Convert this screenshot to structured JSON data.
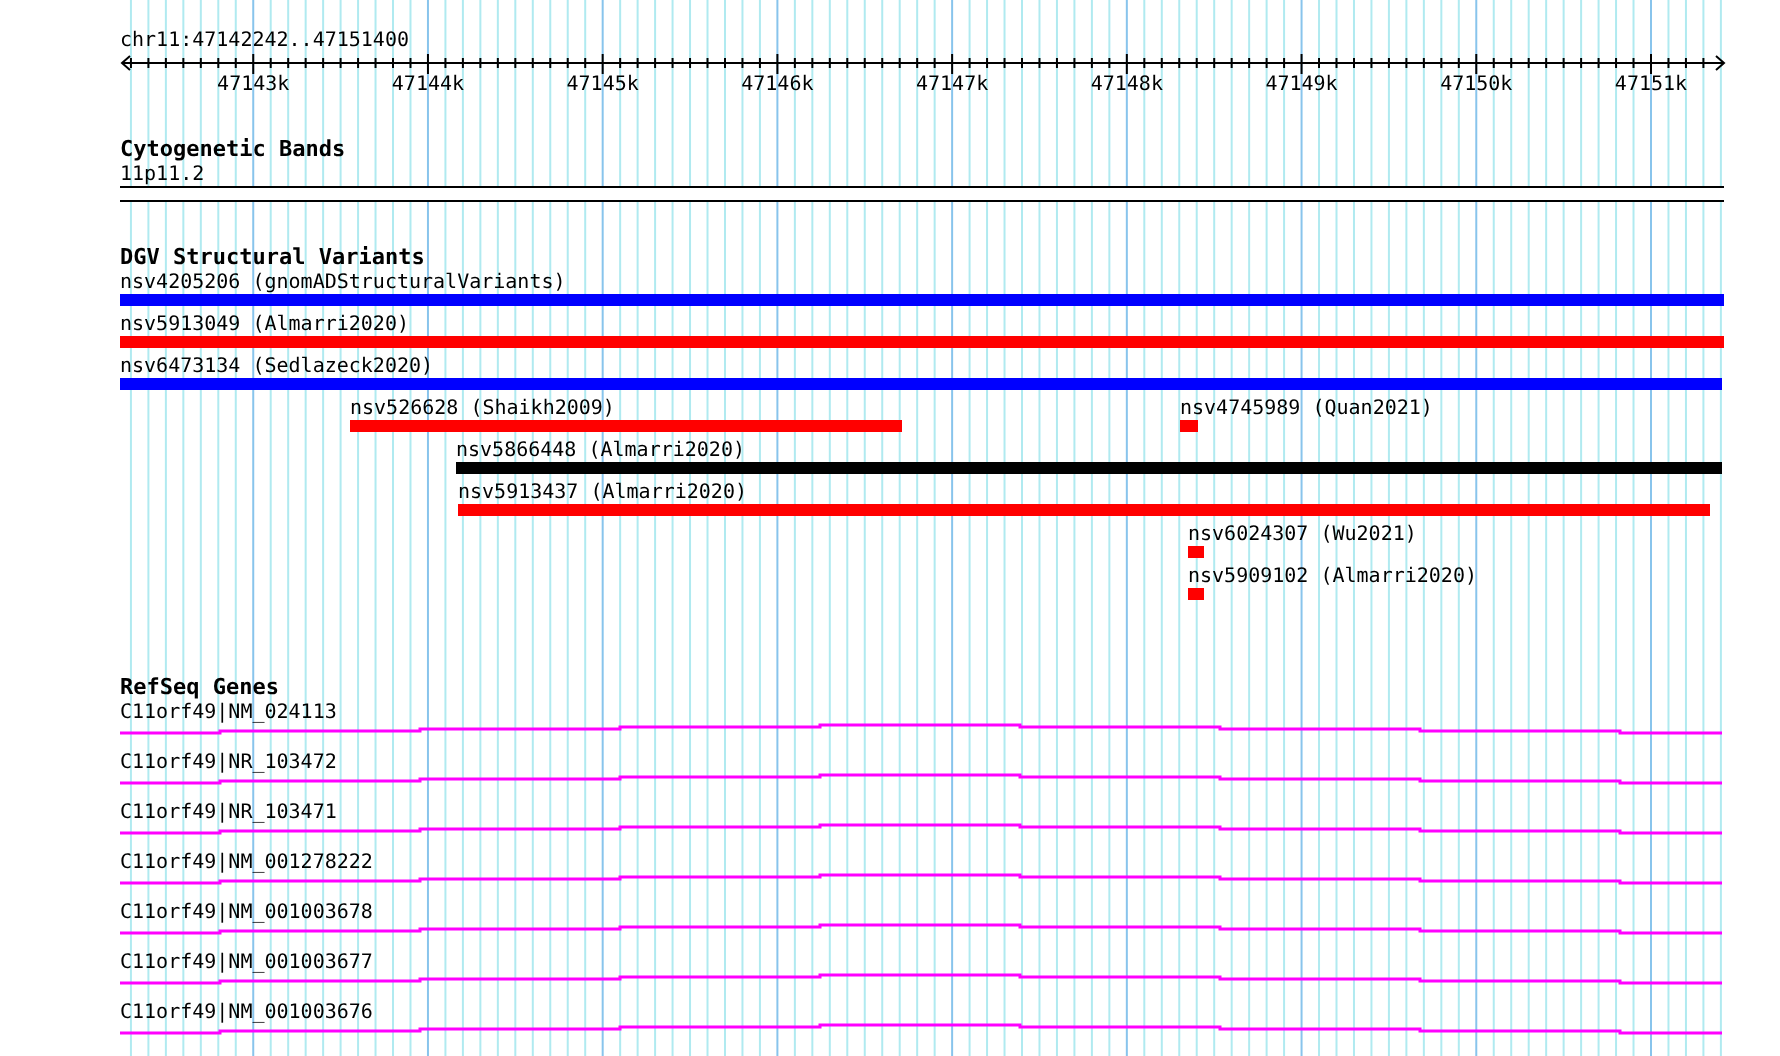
{
  "location": "chr11:47142242..47151400",
  "ruler": {
    "ticks": [
      "47143k",
      "47144k",
      "47145k",
      "47146k",
      "47147k",
      "47148k",
      "47149k",
      "47150k",
      "47151k"
    ]
  },
  "tracks": [
    {
      "kind": "bands",
      "title": "Cytogenetic Bands",
      "features": [
        {
          "label": "11p11.2"
        }
      ]
    },
    {
      "kind": "variants",
      "title": "DGV Structural Variants",
      "features": [
        {
          "label": "nsv4205206 (gnomADStructuralVariants)",
          "color": "#0000ff"
        },
        {
          "label": "nsv5913049 (Almarri2020)",
          "color": "#ff0000"
        },
        {
          "label": "nsv6473134 (Sedlazeck2020)",
          "color": "#0000ff"
        },
        {
          "label": "nsv526628 (Shaikh2009)",
          "color": "#ff0000"
        },
        {
          "label": "nsv4745989 (Quan2021)",
          "color": "#ff0000"
        },
        {
          "label": "nsv5866448 (Almarri2020)",
          "color": "#000000"
        },
        {
          "label": "nsv5913437 (Almarri2020)",
          "color": "#ff0000"
        },
        {
          "label": "nsv6024307 (Wu2021)",
          "color": "#ff0000"
        },
        {
          "label": "nsv5909102 (Almarri2020)",
          "color": "#ff0000"
        }
      ]
    },
    {
      "kind": "genes",
      "title": "RefSeq Genes",
      "features": [
        {
          "label": "C11orf49|NM_024113"
        },
        {
          "label": "C11orf49|NR_103472"
        },
        {
          "label": "C11orf49|NR_103471"
        },
        {
          "label": "C11orf49|NM_001278222"
        },
        {
          "label": "C11orf49|NM_001003678"
        },
        {
          "label": "C11orf49|NM_001003677"
        },
        {
          "label": "C11orf49|NM_001003676"
        }
      ]
    }
  ]
}
